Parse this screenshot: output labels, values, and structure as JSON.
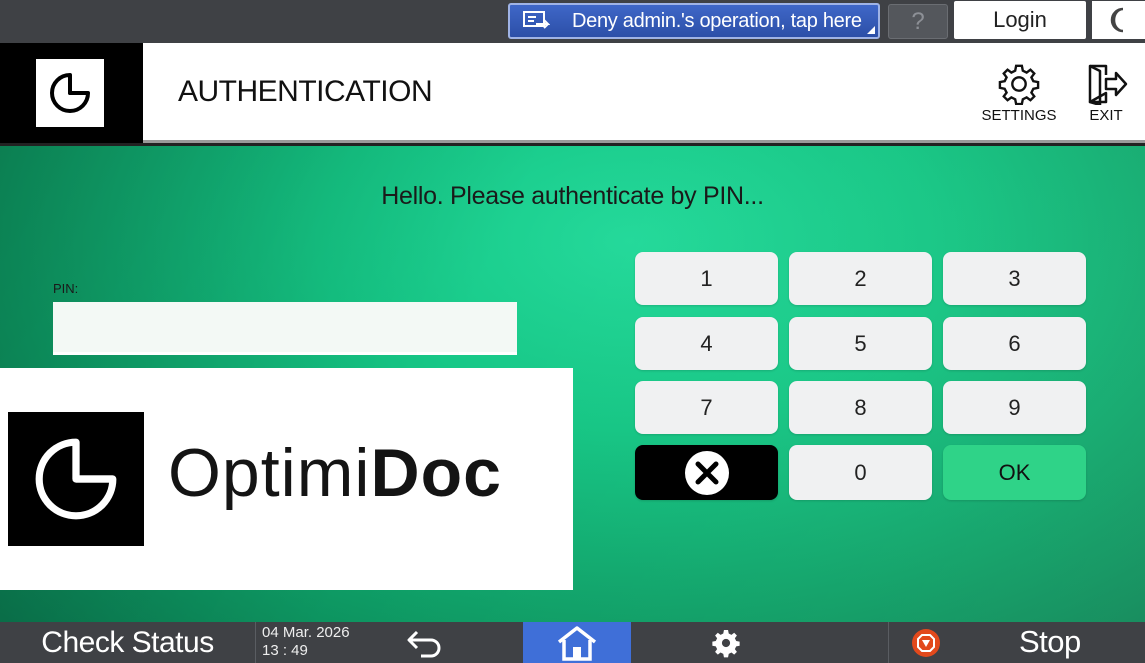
{
  "topbar": {
    "notice_text": "Deny admin.'s operation, tap here",
    "help_label": "?",
    "login_label": "Login"
  },
  "header": {
    "title": "AUTHENTICATION",
    "settings_label": "SETTINGS",
    "exit_label": "EXIT"
  },
  "main": {
    "greeting": "Hello. Please authenticate by PIN...",
    "pin_label": "PIN:",
    "pin_value": "",
    "keypad": {
      "k1": "1",
      "k2": "2",
      "k3": "3",
      "k4": "4",
      "k5": "5",
      "k6": "6",
      "k7": "7",
      "k8": "8",
      "k9": "9",
      "k0": "0",
      "ok": "OK"
    },
    "brand": {
      "name_light": "Optimi",
      "name_bold": "Doc"
    }
  },
  "bottombar": {
    "check_status": "Check Status",
    "date": "04 Mar. 2026",
    "time": "13 : 49",
    "stop_label": "Stop"
  },
  "colors": {
    "accent_green": "#2fd388",
    "home_blue": "#3f6fd8",
    "stop_orange": "#e2491c",
    "bar_gray": "#3f4145"
  },
  "icons": {
    "notice": "remote-panel-icon",
    "settings": "gear-icon",
    "exit": "exit-door-icon",
    "back": "back-arrow-icon",
    "home": "home-icon",
    "stop": "stop-icon",
    "dark_mode": "moon-icon",
    "clear": "clear-x-icon"
  }
}
